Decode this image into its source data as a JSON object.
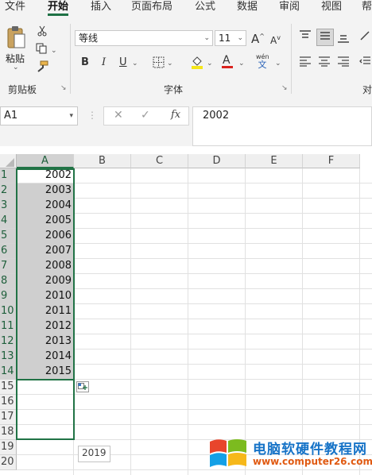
{
  "ribbon": {
    "tabs": [
      {
        "label": "文件",
        "active": false
      },
      {
        "label": "开始",
        "active": true
      },
      {
        "label": "插入",
        "active": false
      },
      {
        "label": "页面布局",
        "active": false
      },
      {
        "label": "公式",
        "active": false
      },
      {
        "label": "数据",
        "active": false
      },
      {
        "label": "审阅",
        "active": false
      },
      {
        "label": "视图",
        "active": false
      },
      {
        "label": "帮",
        "active": false
      }
    ],
    "clipboard": {
      "paste_label": "粘贴",
      "group_label": "剪贴板"
    },
    "font": {
      "name": "等线",
      "size": "11",
      "group_label": "字体",
      "bold": "B",
      "italic": "I",
      "underline": "U",
      "font_color_letter": "A",
      "grow": "A",
      "shrink": "A",
      "phonetic_top": "wén",
      "phonetic_bottom": "文",
      "fill_color": "#f5e61a",
      "font_color": "#d9231f"
    },
    "alignment": {
      "group_label_partial": "对"
    }
  },
  "formula_bar": {
    "name_box": "A1",
    "cancel": "✕",
    "confirm": "✓",
    "fx": "fx",
    "value": "2002"
  },
  "grid": {
    "columns": [
      "A",
      "B",
      "C",
      "D",
      "E",
      "F"
    ],
    "selected_column": "A",
    "rows": [
      "1",
      "2",
      "3",
      "4",
      "5",
      "6",
      "7",
      "8",
      "9",
      "10",
      "11",
      "12",
      "13",
      "14",
      "15",
      "16",
      "17",
      "18",
      "19",
      "20"
    ],
    "column_a_values": [
      "2002",
      "2003",
      "2004",
      "2005",
      "2006",
      "2007",
      "2008",
      "2009",
      "2010",
      "2011",
      "2012",
      "2013",
      "2014",
      "2015"
    ],
    "fill_tooltip": "2019"
  },
  "watermark": {
    "title": "电脑软硬件教程网",
    "url": "www.computer26.com",
    "colors": [
      "#e8452c",
      "#7cbb1f",
      "#14a0e6",
      "#f6b81a"
    ]
  },
  "colors": {
    "accent": "#217346",
    "fill": "#cfcfcf"
  }
}
